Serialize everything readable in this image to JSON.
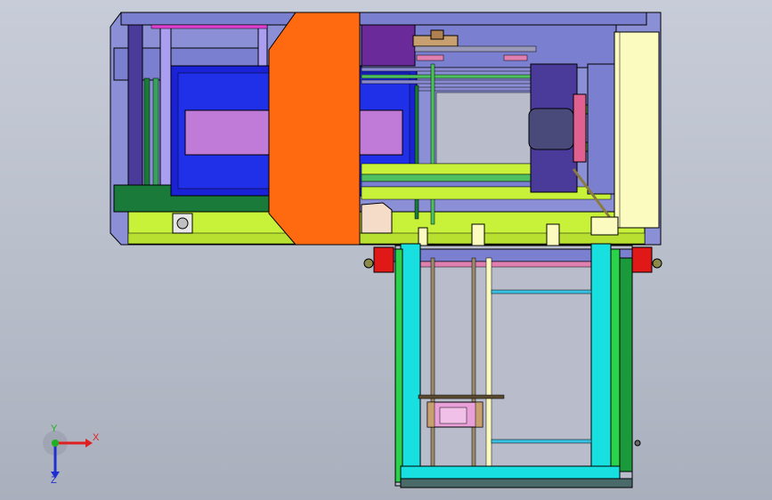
{
  "triad": {
    "x_label": "X",
    "y_label": "Y",
    "z_label": "Z",
    "x_color": "#e02020",
    "y_color": "#20b020",
    "z_color": "#2030d0"
  },
  "colors": {
    "background": "#bcc2ce",
    "frame_lavender": "#7b7fd0",
    "frame_violet": "#4a3a9a",
    "guard_orange": "#ff6a10",
    "bed_blue": "#1a22d8",
    "bed_inner": "#c07ad8",
    "rail_lime": "#c8f23a",
    "base_green": "#1a7a3a",
    "cover_cream": "#fbfbc0",
    "leg_cyan": "#19e0e0",
    "leg_green": "#2ad44a",
    "clamp_red": "#e01818"
  }
}
